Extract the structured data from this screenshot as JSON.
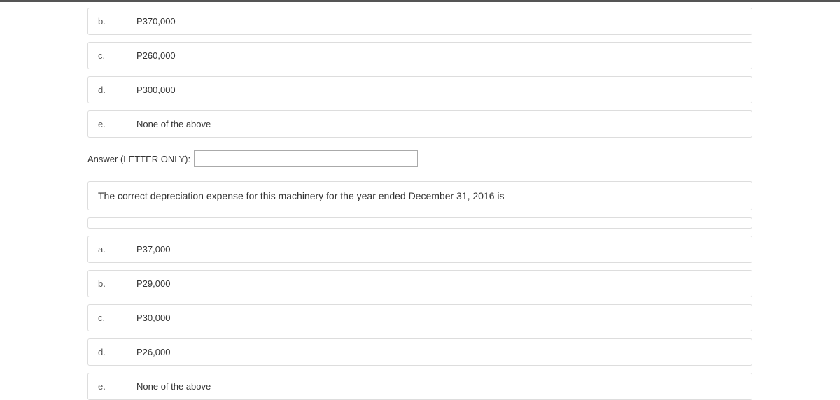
{
  "question1": {
    "options": [
      {
        "letter": "b.",
        "text": "P370,000"
      },
      {
        "letter": "c.",
        "text": "P260,000"
      },
      {
        "letter": "d.",
        "text": "P300,000"
      },
      {
        "letter": "e.",
        "text": "None of the above"
      }
    ],
    "answer_label": "Answer (LETTER ONLY):",
    "answer_value": ""
  },
  "question2": {
    "prompt": "The correct depreciation expense for this machinery for the year ended December 31, 2016 is",
    "options": [
      {
        "letter": "a.",
        "text": "P37,000"
      },
      {
        "letter": "b.",
        "text": "P29,000"
      },
      {
        "letter": "c.",
        "text": "P30,000"
      },
      {
        "letter": "d.",
        "text": "P26,000"
      },
      {
        "letter": "e.",
        "text": "None of the above"
      }
    ]
  }
}
